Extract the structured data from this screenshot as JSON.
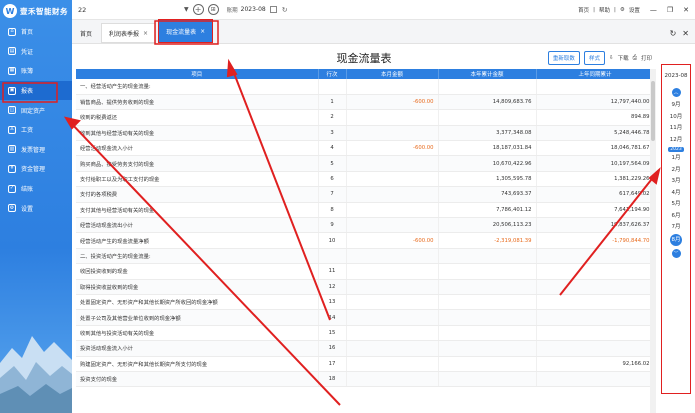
{
  "app": {
    "brand": "壹禾智能财务",
    "logo_letter": "W"
  },
  "sidebar": {
    "items": [
      {
        "label": "首页",
        "icon": "home-icon"
      },
      {
        "label": "凭证",
        "icon": "voucher-icon"
      },
      {
        "label": "账簿",
        "icon": "ledger-icon"
      },
      {
        "label": "报表",
        "icon": "report-icon"
      },
      {
        "label": "固定资产",
        "icon": "asset-icon"
      },
      {
        "label": "工资",
        "icon": "salary-icon"
      },
      {
        "label": "发票管理",
        "icon": "invoice-icon"
      },
      {
        "label": "资金管理",
        "icon": "fund-icon"
      },
      {
        "label": "结账",
        "icon": "close-books-icon"
      },
      {
        "label": "设置",
        "icon": "settings-icon"
      }
    ]
  },
  "topbar": {
    "company": "22",
    "period_label": "账期",
    "period_value": "2023-08",
    "links": [
      "首页",
      "帮助",
      "设置"
    ]
  },
  "tabs": {
    "home": "首页",
    "items": [
      {
        "label": "利润表季报"
      },
      {
        "label": "现金流量表"
      }
    ]
  },
  "report": {
    "title": "现金流量表",
    "buttons": {
      "reset": "重新取数",
      "style": "样式",
      "download": "下载",
      "print": "打印"
    },
    "headers": [
      "项目",
      "行次",
      "本月金额",
      "本年累计金额",
      "上年同期累计"
    ],
    "rows": [
      {
        "item": "一、经营活动产生的现金流量:",
        "line": "",
        "month": "",
        "ytd": "",
        "prior": "",
        "neg": false
      },
      {
        "item": "销售商品、提供劳务收到的现金",
        "line": "1",
        "month": "-600.00",
        "ytd": "14,809,683.76",
        "prior": "12,797,440.00",
        "neg": false
      },
      {
        "item": "收到的税费返还",
        "line": "2",
        "month": "",
        "ytd": "",
        "prior": "894.89",
        "neg": false
      },
      {
        "item": "收到其他与经营活动有关的现金",
        "line": "3",
        "month": "",
        "ytd": "3,377,348.08",
        "prior": "5,248,446.78",
        "neg": false
      },
      {
        "item": "经营活动现金流入小计",
        "line": "4",
        "month": "-600.00",
        "ytd": "18,187,031.84",
        "prior": "18,046,781.67",
        "neg": false
      },
      {
        "item": "购买商品、接受劳务支付的现金",
        "line": "5",
        "month": "",
        "ytd": "10,670,422.96",
        "prior": "10,197,564.09",
        "neg": false
      },
      {
        "item": "支付给职工以及为职工支付的现金",
        "line": "6",
        "month": "",
        "ytd": "1,305,595.78",
        "prior": "1,381,229.26",
        "neg": false
      },
      {
        "item": "支付的各项税费",
        "line": "7",
        "month": "",
        "ytd": "743,693.37",
        "prior": "617,649.02",
        "neg": false
      },
      {
        "item": "支付其他与经营活动有关的现金",
        "line": "8",
        "month": "",
        "ytd": "7,786,401.12",
        "prior": "7,641,194.90",
        "neg": false
      },
      {
        "item": "经营活动现金流出小计",
        "line": "9",
        "month": "",
        "ytd": "20,506,113.23",
        "prior": "19,837,626.37",
        "neg": false
      },
      {
        "item": "经营活动产生的现金流量净额",
        "line": "10",
        "month": "-600.00",
        "ytd": "-2,319,081.39",
        "prior": "-1,790,844.70",
        "neg": true
      },
      {
        "item": "二、投资活动产生的现金流量:",
        "line": "",
        "month": "",
        "ytd": "",
        "prior": "",
        "neg": false
      },
      {
        "item": "收回投资收到的现金",
        "line": "11",
        "month": "",
        "ytd": "",
        "prior": "",
        "neg": false
      },
      {
        "item": "取得投资收益收到的现金",
        "line": "12",
        "month": "",
        "ytd": "",
        "prior": "",
        "neg": false
      },
      {
        "item": "处置固定资产、无形资产和其他长期资产所收回的现金净额",
        "line": "13",
        "month": "",
        "ytd": "",
        "prior": "",
        "neg": false
      },
      {
        "item": "处置子公司及其他营业单位收到的现金净额",
        "line": "14",
        "month": "",
        "ytd": "",
        "prior": "",
        "neg": false
      },
      {
        "item": "收到其他与投资活动有关的现金",
        "line": "15",
        "month": "",
        "ytd": "",
        "prior": "",
        "neg": false
      },
      {
        "item": "投资活动现金流入小计",
        "line": "16",
        "month": "",
        "ytd": "",
        "prior": "",
        "neg": false
      },
      {
        "item": "购建固定资产、无形资产和其他长期资产所支付的现金",
        "line": "17",
        "month": "",
        "ytd": "",
        "prior": "92,166.02",
        "neg": false
      },
      {
        "item": "投资支付的现金",
        "line": "18",
        "month": "",
        "ytd": "",
        "prior": "",
        "neg": false
      }
    ]
  },
  "periods": {
    "year": "2023-08",
    "year_tag": "2023",
    "months": [
      "9月",
      "10月",
      "11月",
      "12月",
      "1月",
      "2月",
      "3月",
      "4月",
      "5月",
      "6月",
      "7月",
      "8月"
    ],
    "selected": "8月"
  },
  "colors": {
    "accent": "#2d7fe0",
    "annotation": "#e02020",
    "negative": "#e86a1c"
  }
}
